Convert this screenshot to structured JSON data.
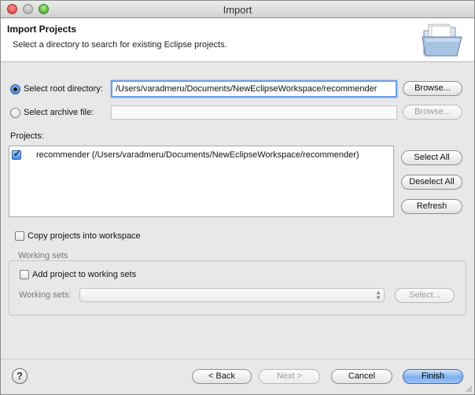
{
  "window": {
    "title": "Import"
  },
  "header": {
    "title": "Import Projects",
    "description": "Select a directory to search for existing Eclipse projects.",
    "icon": "folder-icon"
  },
  "source": {
    "root_label": "Select root directory:",
    "root_value": "/Users/varadmeru/Documents/NewEclipseWorkspace/recommender",
    "root_selected": true,
    "root_browse": "Browse...",
    "archive_label": "Select archive file:",
    "archive_value": "",
    "archive_browse": "Browse..."
  },
  "projects": {
    "label": "Projects:",
    "items": [
      {
        "label": "recommender (/Users/varadmeru/Documents/NewEclipseWorkspace/recommender)",
        "checked": true
      }
    ],
    "select_all": "Select All",
    "deselect_all": "Deselect All",
    "refresh": "Refresh"
  },
  "copy_into_workspace": {
    "label": "Copy projects into workspace",
    "checked": false
  },
  "working_sets": {
    "group_label": "Working sets",
    "add_label": "Add project to working sets",
    "add_checked": false,
    "sets_label": "Working sets:",
    "sets_value": "",
    "select_button": "Select..."
  },
  "footer": {
    "help": "?",
    "back": "< Back",
    "next": "Next >",
    "cancel": "Cancel",
    "finish": "Finish"
  },
  "colors": {
    "accent": "#4a8ae0",
    "focus_ring": "#6a9ee8"
  }
}
